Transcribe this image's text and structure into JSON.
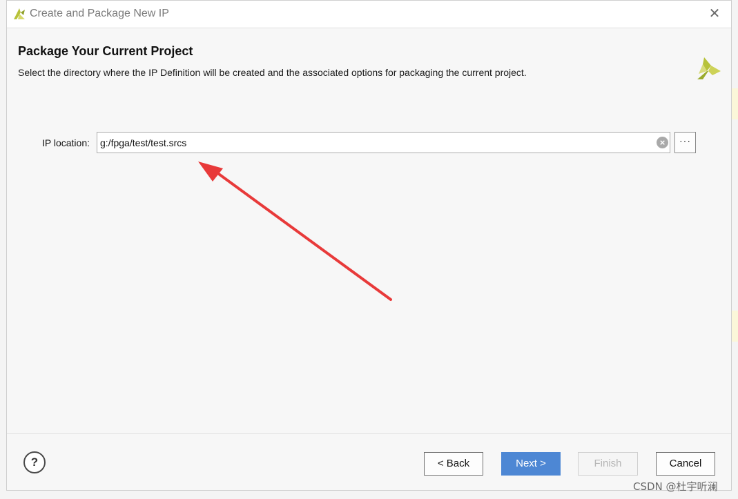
{
  "window": {
    "title": "Create and Package New IP",
    "close_icon": "close-icon"
  },
  "header": {
    "title": "Package Your Current Project",
    "description": "Select the directory where the IP Definition will be created and the associated options for packaging the current project."
  },
  "form": {
    "ip_location_label": "IP location:",
    "ip_location_value": "g:/fpga/test/test.srcs",
    "clear_icon": "clear-icon",
    "browse_label": "···"
  },
  "footer": {
    "help_label": "?",
    "back_label": "< Back",
    "next_label": "Next >",
    "finish_label": "Finish",
    "cancel_label": "Cancel"
  },
  "watermark": "CSDN @杜宇听澜",
  "colors": {
    "accent": "#4d87d4",
    "arrow": "#e83a3a",
    "brand_logo": "#b7c23a"
  }
}
